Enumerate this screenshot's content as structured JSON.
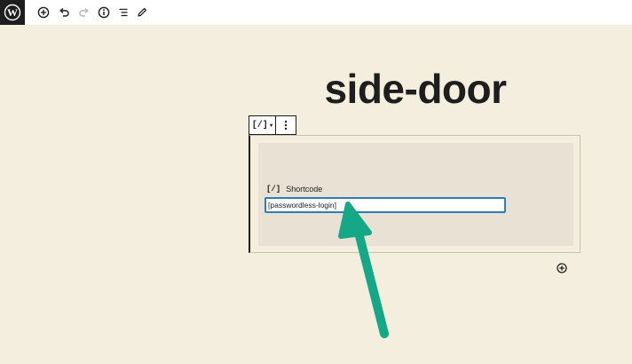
{
  "toolbar": {
    "logo_icon": "wordpress-icon",
    "buttons": [
      {
        "name": "add-block-toolbar-button",
        "icon": "plus-circle-icon"
      },
      {
        "name": "undo-button",
        "icon": "undo-icon"
      },
      {
        "name": "redo-button",
        "icon": "redo-icon"
      },
      {
        "name": "info-button",
        "icon": "info-icon"
      },
      {
        "name": "list-view-button",
        "icon": "list-view-icon"
      },
      {
        "name": "edit-mode-button",
        "icon": "pencil-icon"
      }
    ]
  },
  "page": {
    "title": "side-door"
  },
  "block": {
    "type_icon_label": "[/]",
    "label": "Shortcode",
    "input_value": "[passwordless-login]"
  },
  "colors": {
    "background": "#f4eedf",
    "block_fill": "#e9e2d4",
    "input_focus": "#2f7db8",
    "arrow": "#14a887",
    "text": "#1e1e1e"
  }
}
